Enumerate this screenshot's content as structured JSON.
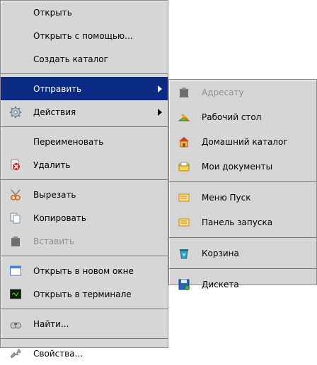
{
  "main_menu": {
    "items": [
      {
        "label": "Открыть"
      },
      {
        "label": "Открыть с помощью..."
      },
      {
        "label": "Создать каталог"
      },
      {
        "label": "Отправить"
      },
      {
        "label": "Действия"
      },
      {
        "label": "Переименовать"
      },
      {
        "label": "Удалить"
      },
      {
        "label": "Вырезать"
      },
      {
        "label": "Копировать"
      },
      {
        "label": "Вставить"
      },
      {
        "label": "Открыть в новом окне"
      },
      {
        "label": "Открыть в терминале"
      },
      {
        "label": "Найти..."
      },
      {
        "label": "Свойства..."
      }
    ]
  },
  "send_submenu": {
    "items": [
      {
        "label": "Адресату"
      },
      {
        "label": "Рабочий стол"
      },
      {
        "label": "Домашний каталог"
      },
      {
        "label": "Мои документы"
      },
      {
        "label": "Меню Пуск"
      },
      {
        "label": "Панель запуска"
      },
      {
        "label": "Корзина"
      },
      {
        "label": "Дискета"
      }
    ]
  },
  "colors": {
    "menu_bg": "#d6d6d6",
    "selection": "#0b2a84",
    "disabled_text": "#8e8e8e"
  }
}
